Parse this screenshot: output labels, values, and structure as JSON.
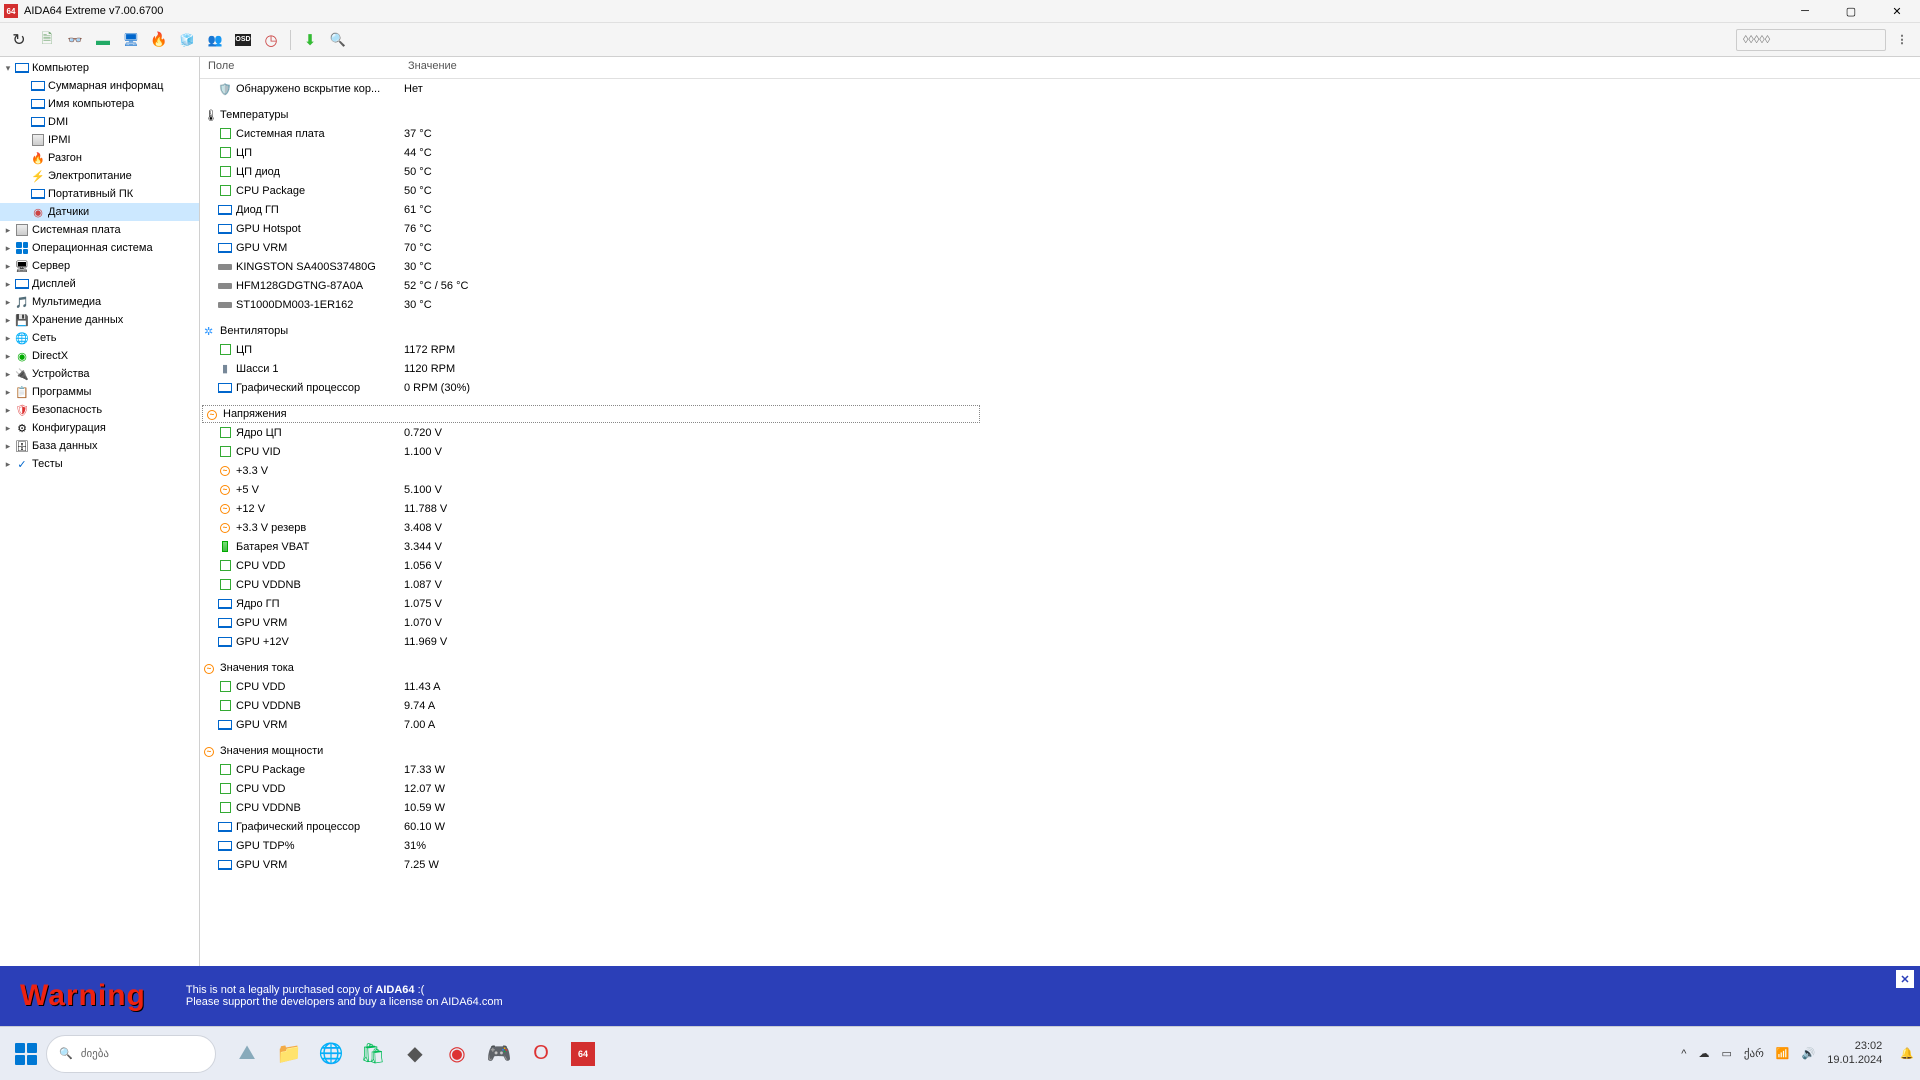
{
  "window": {
    "title": "AIDA64 Extreme v7.00.6700",
    "app_badge": "64"
  },
  "toolbar": {
    "search_placeholder": "◊◊◊◊◊",
    "buttons": [
      {
        "name": "refresh-button",
        "glyph": "↻",
        "fs": 16,
        "col": "#333"
      },
      {
        "name": "report-button",
        "glyph": "🗎",
        "fs": 14,
        "col": "#7a7"
      },
      {
        "name": "glasses-button",
        "glyph": "👓",
        "fs": 12,
        "col": "#333"
      },
      {
        "name": "board-button",
        "glyph": "▬",
        "fs": 14,
        "col": "#2a6"
      },
      {
        "name": "monitor-button",
        "glyph": "🖥",
        "fs": 13,
        "col": "#06c"
      },
      {
        "name": "benchmark-button",
        "glyph": "🔥",
        "fs": 14,
        "col": "#f60"
      },
      {
        "name": "sensor-icon-button",
        "glyph": "🧊",
        "fs": 12,
        "col": "#39f"
      },
      {
        "name": "users-button",
        "glyph": "👥",
        "fs": 12,
        "col": "#555"
      },
      {
        "name": "osd-button",
        "glyph": "OSD",
        "osd": true
      },
      {
        "name": "clock-button",
        "glyph": "◷",
        "fs": 15,
        "col": "#c44"
      },
      {
        "sep": true
      },
      {
        "name": "download-button",
        "glyph": "⬇",
        "fs": 15,
        "col": "#3b3"
      },
      {
        "name": "search-button",
        "glyph": "🔍",
        "fs": 13,
        "col": "#39f"
      }
    ]
  },
  "tree": [
    {
      "d": 0,
      "exp": "▾",
      "icon": "monitor",
      "col": "#06c",
      "label": "Компьютер"
    },
    {
      "d": 1,
      "icon": "monitor",
      "col": "#06c",
      "label": "Суммарная информац"
    },
    {
      "d": 1,
      "icon": "monitor",
      "col": "#06c",
      "label": "Имя компьютера"
    },
    {
      "d": 1,
      "icon": "monitor",
      "col": "#06c",
      "label": "DMI"
    },
    {
      "d": 1,
      "icon": "chip",
      "col": "#c80",
      "label": "IPMI"
    },
    {
      "d": 1,
      "icon": "flame",
      "col": "#f70",
      "label": "Разгон"
    },
    {
      "d": 1,
      "icon": "power",
      "col": "#f0c000",
      "label": "Электропитание"
    },
    {
      "d": 1,
      "icon": "monitor",
      "col": "#06c",
      "label": "Портативный ПК"
    },
    {
      "d": 1,
      "icon": "sensor",
      "col": "#c44",
      "label": "Датчики",
      "sel": true
    },
    {
      "d": 0,
      "exp": "▸",
      "icon": "chip",
      "col": "#888",
      "label": "Системная плата"
    },
    {
      "d": 0,
      "exp": "▸",
      "icon": "win",
      "col": "#06c",
      "label": "Операционная система"
    },
    {
      "d": 0,
      "exp": "▸",
      "icon": "server",
      "col": "#555",
      "label": "Сервер"
    },
    {
      "d": 0,
      "exp": "▸",
      "icon": "monitor",
      "col": "#06c",
      "label": "Дисплей"
    },
    {
      "d": 0,
      "exp": "▸",
      "icon": "mm",
      "col": "#a5a",
      "label": "Мультимедиа"
    },
    {
      "d": 0,
      "exp": "▸",
      "icon": "hdd",
      "col": "#888",
      "label": "Хранение данных"
    },
    {
      "d": 0,
      "exp": "▸",
      "icon": "net",
      "col": "#0a0",
      "label": "Сеть"
    },
    {
      "d": 0,
      "exp": "▸",
      "icon": "dx",
      "col": "#0a0",
      "label": "DirectX"
    },
    {
      "d": 0,
      "exp": "▸",
      "icon": "dev",
      "col": "#555",
      "label": "Устройства"
    },
    {
      "d": 0,
      "exp": "▸",
      "icon": "prog",
      "col": "#c80",
      "label": "Программы"
    },
    {
      "d": 0,
      "exp": "▸",
      "icon": "sec",
      "col": "#d33",
      "label": "Безопасность"
    },
    {
      "d": 0,
      "exp": "▸",
      "icon": "gear",
      "col": "#888",
      "label": "Конфигурация"
    },
    {
      "d": 0,
      "exp": "▸",
      "icon": "db",
      "col": "#c80",
      "label": "База данных"
    },
    {
      "d": 0,
      "exp": "▸",
      "icon": "test",
      "col": "#06c",
      "label": "Тесты"
    }
  ],
  "columns": {
    "c1": "Поле",
    "c2": "Значение"
  },
  "top_row": {
    "icon": "shield",
    "label": "Обнаружено вскрытие кор...",
    "value": "Нет"
  },
  "sections": [
    {
      "name": "temperatures",
      "icon": "therm",
      "title": "Температуры",
      "rows": [
        {
          "icon": "cpu",
          "label": "Системная плата",
          "value": "37 °C"
        },
        {
          "icon": "cpu",
          "label": "ЦП",
          "value": "44 °C"
        },
        {
          "icon": "cpu",
          "label": "ЦП диод",
          "value": "50 °C"
        },
        {
          "icon": "cpu",
          "label": "CPU Package",
          "value": "50 °C"
        },
        {
          "icon": "gpu",
          "label": "Диод ГП",
          "value": "61 °C"
        },
        {
          "icon": "gpu",
          "label": "GPU Hotspot",
          "value": "76 °C"
        },
        {
          "icon": "gpu",
          "label": "GPU VRM",
          "value": "70 °C"
        },
        {
          "icon": "hdd",
          "label": "KINGSTON SA400S37480G",
          "value": "30 °C"
        },
        {
          "icon": "hdd",
          "label": "HFM128GDGTNG-87A0A",
          "value": "52 °C / 56 °C"
        },
        {
          "icon": "hdd",
          "label": "ST1000DM003-1ER162",
          "value": "30 °C"
        }
      ]
    },
    {
      "name": "fans",
      "icon": "fan",
      "title": "Вентиляторы",
      "rows": [
        {
          "icon": "cpu",
          "label": "ЦП",
          "value": "1172 RPM"
        },
        {
          "icon": "case",
          "label": "Шасси 1",
          "value": "1120 RPM"
        },
        {
          "icon": "gpu",
          "label": "Графический процессор",
          "value": "0 RPM  (30%)"
        }
      ]
    },
    {
      "name": "voltages",
      "icon": "volt",
      "title": "Напряжения",
      "boxed": true,
      "rows": [
        {
          "icon": "cpu",
          "label": "Ядро ЦП",
          "value": "0.720 V"
        },
        {
          "icon": "cpu",
          "label": "CPU VID",
          "value": "1.100 V"
        },
        {
          "icon": "volt",
          "label": "+3.3 V",
          "value": ""
        },
        {
          "icon": "volt",
          "label": "+5 V",
          "value": "5.100 V"
        },
        {
          "icon": "volt",
          "label": "+12 V",
          "value": "11.788 V"
        },
        {
          "icon": "volt",
          "label": "+3.3 V резерв",
          "value": "3.408 V"
        },
        {
          "icon": "batt",
          "label": "Батарея VBAT",
          "value": "3.344 V"
        },
        {
          "icon": "cpu",
          "label": "CPU VDD",
          "value": "1.056 V"
        },
        {
          "icon": "cpu",
          "label": "CPU VDDNB",
          "value": "1.087 V"
        },
        {
          "icon": "gpu",
          "label": "Ядро ГП",
          "value": "1.075 V"
        },
        {
          "icon": "gpu",
          "label": "GPU VRM",
          "value": "1.070 V"
        },
        {
          "icon": "gpu",
          "label": "GPU +12V",
          "value": "11.969 V"
        }
      ]
    },
    {
      "name": "currents",
      "icon": "volt",
      "title": "Значения тока",
      "rows": [
        {
          "icon": "cpu",
          "label": "CPU VDD",
          "value": "11.43 A"
        },
        {
          "icon": "cpu",
          "label": "CPU VDDNB",
          "value": "9.74 A"
        },
        {
          "icon": "gpu",
          "label": "GPU VRM",
          "value": "7.00 A"
        }
      ]
    },
    {
      "name": "power",
      "icon": "volt",
      "title": "Значения мощности",
      "rows": [
        {
          "icon": "cpu",
          "label": "CPU Package",
          "value": "17.33 W"
        },
        {
          "icon": "cpu",
          "label": "CPU VDD",
          "value": "12.07 W"
        },
        {
          "icon": "cpu",
          "label": "CPU VDDNB",
          "value": "10.59 W"
        },
        {
          "icon": "gpu",
          "label": "Графический процессор",
          "value": "60.10 W"
        },
        {
          "icon": "gpu",
          "label": "GPU TDP%",
          "value": "31%"
        },
        {
          "icon": "gpu",
          "label": "GPU VRM",
          "value": "7.25 W"
        }
      ]
    }
  ],
  "warning": {
    "title": "Warning",
    "line1a": "This is not a legally purchased copy of ",
    "line1b": "AIDA64",
    "line1c": " :(",
    "line2": "Please support the developers and buy a license on AIDA64.com"
  },
  "taskbar": {
    "search": "ძიება",
    "tasks": [
      {
        "name": "task-app1",
        "col": "#8ab",
        "glyph": "⛰"
      },
      {
        "name": "task-explorer",
        "col": "#f5c04a",
        "glyph": "📁"
      },
      {
        "name": "task-edge",
        "col": "#1e88e5",
        "glyph": "🌐"
      },
      {
        "name": "task-store",
        "col": "#0b5",
        "glyph": "🛍"
      },
      {
        "name": "task-app2",
        "col": "#555",
        "glyph": "◆"
      },
      {
        "name": "task-app3",
        "col": "#d33",
        "glyph": "◉"
      },
      {
        "name": "task-app4",
        "col": "#c77",
        "glyph": "🎮"
      },
      {
        "name": "task-opera",
        "col": "#d33",
        "glyph": "O"
      },
      {
        "name": "task-aida64",
        "col": "#d32f2f",
        "glyph": "64",
        "badge": true
      }
    ],
    "lang": "ქარ",
    "time": "23:02",
    "date": "19.01.2024"
  }
}
